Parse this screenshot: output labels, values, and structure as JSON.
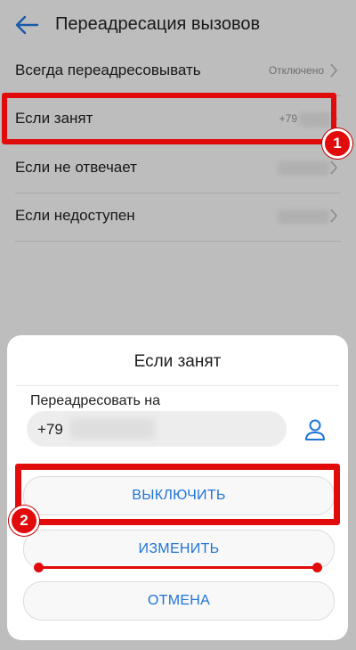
{
  "appbar": {
    "title": "Переадресация вызовов",
    "back_icon": "arrow-left-icon"
  },
  "settings": {
    "rows": [
      {
        "label": "Всегда переадресовывать",
        "value": "Отключено"
      },
      {
        "label": "Если занят",
        "value": "+79"
      },
      {
        "label": "Если не отвечает",
        "value": ""
      },
      {
        "label": "Если недоступен",
        "value": ""
      }
    ]
  },
  "dialog": {
    "title": "Если занят",
    "field_label": "Переадресовать на",
    "phone_value": "+79",
    "contact_icon": "person-icon",
    "buttons": {
      "off": "ВЫКЛЮЧИТЬ",
      "edit": "ИЗМЕНИТЬ",
      "cancel": "ОТМЕНА"
    }
  },
  "annotations": {
    "badge1": "1",
    "badge2": "2"
  },
  "colors": {
    "accent": "#1f74d8",
    "highlight": "#e10b0b"
  }
}
